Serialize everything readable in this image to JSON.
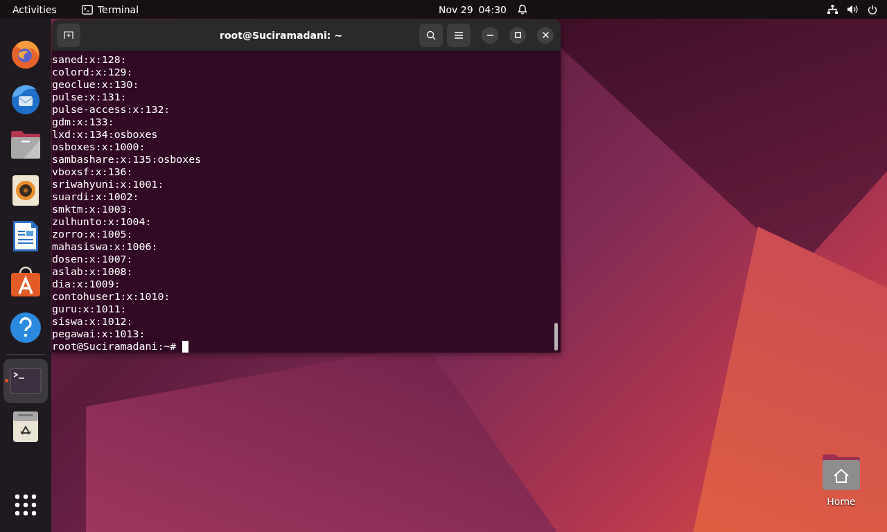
{
  "top_bar": {
    "activities": "Activities",
    "app_menu": "Terminal",
    "date": "Nov 29",
    "time": "04:30"
  },
  "dock": [
    {
      "kind": "firefox",
      "selected": false,
      "running": false
    },
    {
      "kind": "thunderbird",
      "selected": false,
      "running": false
    },
    {
      "kind": "files",
      "selected": false,
      "running": false
    },
    {
      "kind": "rhythmbox",
      "selected": false,
      "running": false
    },
    {
      "kind": "writer",
      "selected": false,
      "running": false
    },
    {
      "kind": "software",
      "selected": false,
      "running": false
    },
    {
      "kind": "help",
      "selected": false,
      "running": false
    },
    {
      "kind": "terminal",
      "selected": true,
      "running": true
    },
    {
      "kind": "trash",
      "selected": false,
      "running": false
    }
  ],
  "terminal": {
    "title": "root@Suciramadani: ~",
    "lines": [
      "saned:x:128:",
      "colord:x:129:",
      "geoclue:x:130:",
      "pulse:x:131:",
      "pulse-access:x:132:",
      "gdm:x:133:",
      "lxd:x:134:osboxes",
      "osboxes:x:1000:",
      "sambashare:x:135:osboxes",
      "vboxsf:x:136:",
      "sriwahyuni:x:1001:",
      "suardi:x:1002:",
      "smktm:x:1003:",
      "zulhunto:x:1004:",
      "zorro:x:1005:",
      "mahasiswa:x:1006:",
      "dosen:x:1007:",
      "aslab:x:1008:",
      "dia:x:1009:",
      "contohuser1:x:1010:",
      "guru:x:1011:",
      "siswa:x:1012:",
      "pegawai:x:1013:"
    ],
    "prompt": "root@Suciramadani:~#"
  },
  "desktop_icons": [
    {
      "label": "Home"
    }
  ]
}
